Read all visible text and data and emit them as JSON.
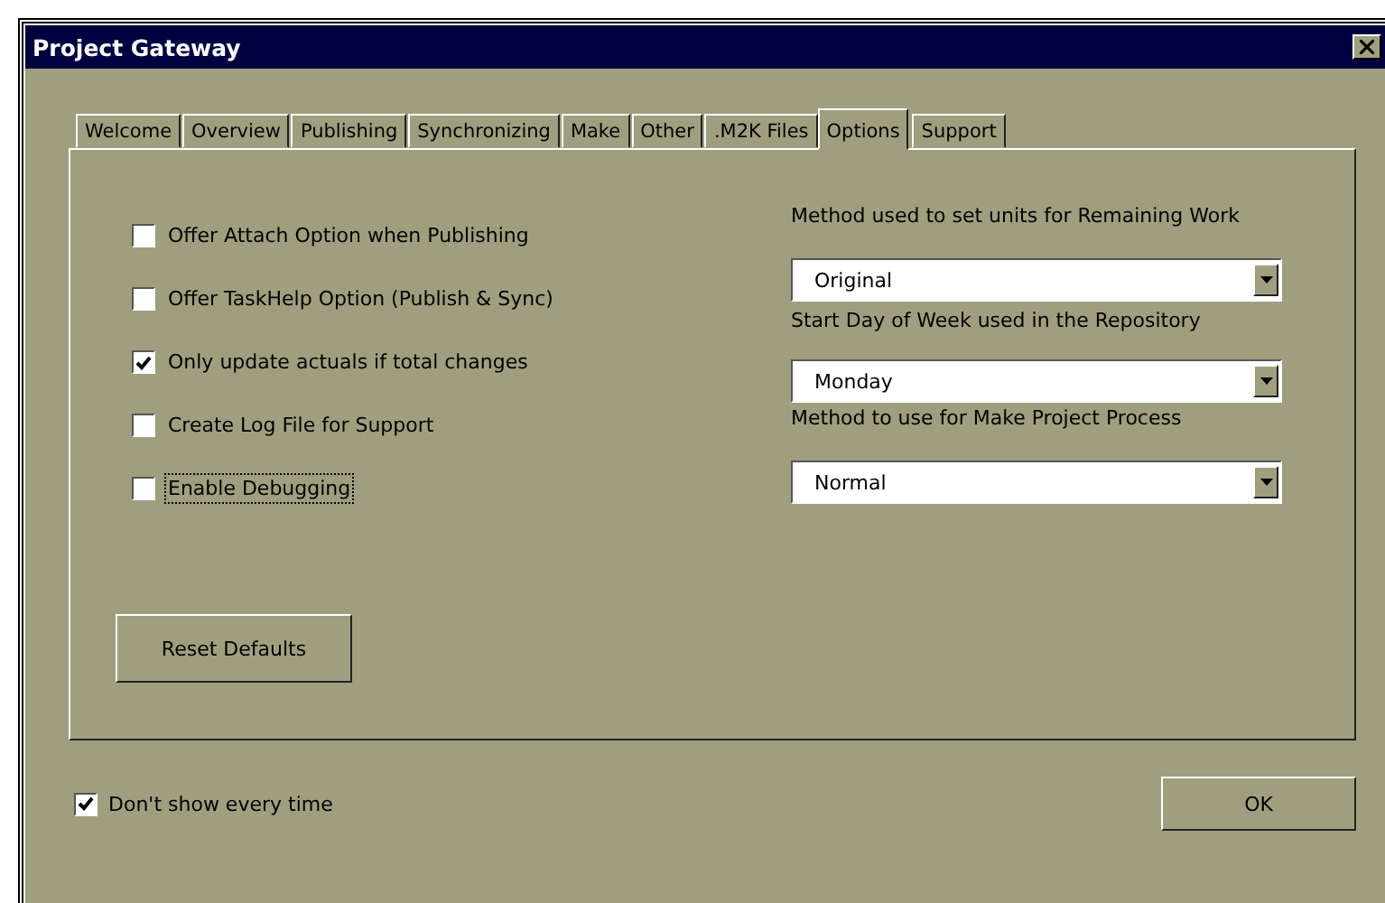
{
  "window": {
    "title": "Project Gateway"
  },
  "tabs": [
    {
      "label": "Welcome",
      "selected": false
    },
    {
      "label": "Overview",
      "selected": false
    },
    {
      "label": "Publishing",
      "selected": false
    },
    {
      "label": "Synchronizing",
      "selected": false
    },
    {
      "label": "Make",
      "selected": false
    },
    {
      "label": "Other",
      "selected": false
    },
    {
      "label": ".M2K Files",
      "selected": false
    },
    {
      "label": "Options",
      "selected": true
    },
    {
      "label": "Support",
      "selected": false
    }
  ],
  "options": [
    {
      "label": "Offer Attach Option when Publishing",
      "checked": false,
      "focused": false
    },
    {
      "label": "Offer TaskHelp Option (Publish & Sync)",
      "checked": false,
      "focused": false
    },
    {
      "label": "Only update actuals if total changes",
      "checked": true,
      "focused": false
    },
    {
      "label": "Create Log File for Support",
      "checked": false,
      "focused": false
    },
    {
      "label": "Enable Debugging",
      "checked": false,
      "focused": true
    }
  ],
  "reset_button": "Reset Defaults",
  "settings": [
    {
      "label": "Method used to set units for Remaining Work",
      "value": "Original"
    },
    {
      "label": "Start Day of Week used in the Repository",
      "value": "Monday"
    },
    {
      "label": "Method to use for Make Project Process",
      "value": "Normal"
    }
  ],
  "dont_show": {
    "label": "Don't show every time",
    "checked": true
  },
  "ok_button": "OK"
}
